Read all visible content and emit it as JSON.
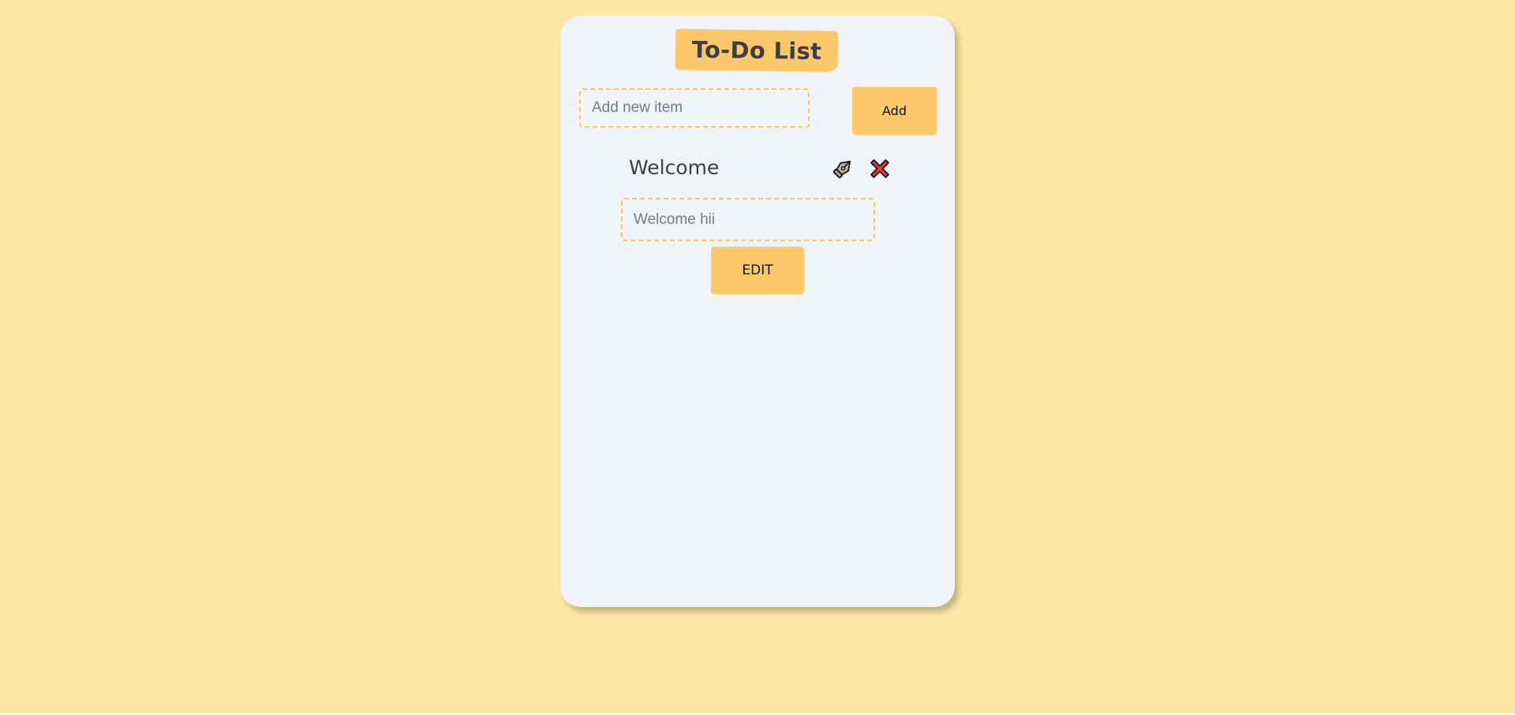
{
  "app": {
    "title": "To-Do List"
  },
  "new_item": {
    "placeholder": "Add new item",
    "value": "",
    "add_label": "Add"
  },
  "items": [
    {
      "title": "Welcome",
      "edit_placeholder": "Welcome hii",
      "edit_icon": "pen-nib-icon",
      "delete_icon": "close-icon"
    }
  ],
  "actions": {
    "edit_label": "EDIT"
  },
  "colors": {
    "page_background": "#ffe8a5",
    "card_background": "#f0f3f7",
    "accent": "#fdc86a",
    "dashed_border": "#fbc463",
    "delete_red": "#e03b2d",
    "text": "#3d3f44"
  }
}
